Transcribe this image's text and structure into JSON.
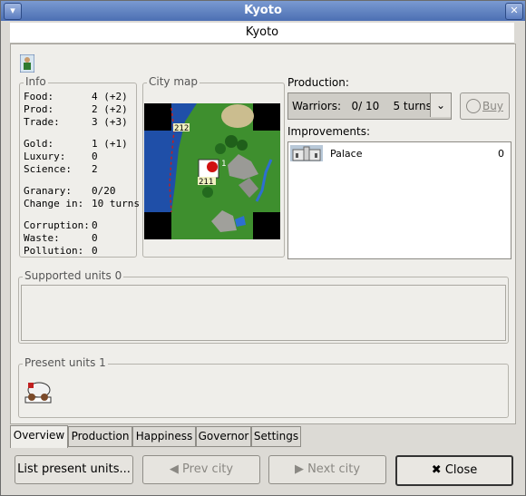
{
  "window": {
    "title": "Kyoto"
  },
  "header": {
    "city_name": "Kyoto"
  },
  "info": {
    "title": "Info",
    "rows": [
      {
        "label": "Food:",
        "value": "4 (+2)"
      },
      {
        "label": "Prod:",
        "value": "2 (+2)"
      },
      {
        "label": "Trade:",
        "value": "3 (+3)"
      },
      {
        "label": "Gold:",
        "value": "1 (+1)"
      },
      {
        "label": "Luxury:",
        "value": "0"
      },
      {
        "label": "Science:",
        "value": "2"
      },
      {
        "label": "Granary:",
        "value": "0/20"
      },
      {
        "label": "Change in:",
        "value": "10 turns"
      },
      {
        "label": "Corruption:",
        "value": "0"
      },
      {
        "label": "Waste:",
        "value": "0"
      },
      {
        "label": "Pollution:",
        "value": "0"
      }
    ]
  },
  "city_map": {
    "title": "City map",
    "tile_labels": {
      "north": "212",
      "center_side": "1",
      "center": "211"
    }
  },
  "production": {
    "label": "Production:",
    "current": "Warriors:   0/ 10    5 turns",
    "buy_label": "Buy"
  },
  "improvements": {
    "label": "Improvements:",
    "items": [
      {
        "name": "Palace",
        "upkeep": "0"
      }
    ]
  },
  "supported_units": {
    "title": "Supported units 0"
  },
  "present_units": {
    "title": "Present units 1"
  },
  "tabs": [
    {
      "label": "Overview"
    },
    {
      "label": "Production"
    },
    {
      "label": "Happiness"
    },
    {
      "label": "Governor"
    },
    {
      "label": "Settings"
    }
  ],
  "buttons": {
    "list_present": "List present units...",
    "prev_city": "Prev city",
    "next_city": "Next city",
    "close": "Close"
  },
  "colors": {
    "title_bar": "#5a7dc1",
    "grassland": "#3e8f2e",
    "ocean": "#1f4fa8"
  }
}
